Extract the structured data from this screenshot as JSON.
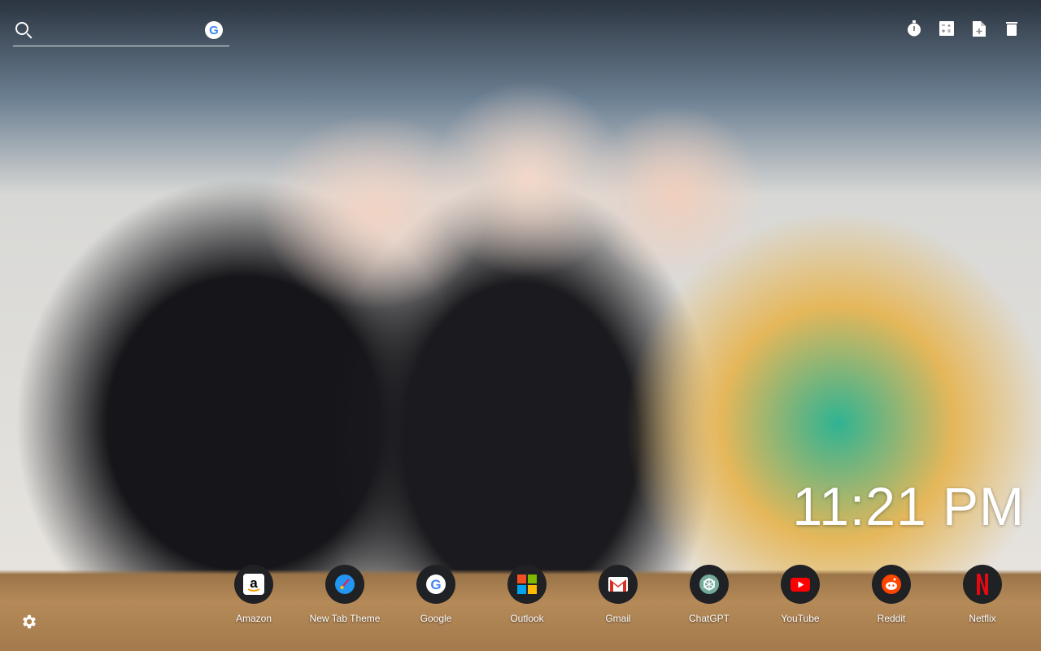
{
  "search": {
    "icon": "search-icon",
    "engine_icon": "google-icon",
    "engine_letter": "G"
  },
  "toolbar": [
    {
      "name": "timer-icon"
    },
    {
      "name": "calculator-icon"
    },
    {
      "name": "add-note-icon"
    },
    {
      "name": "trash-icon"
    }
  ],
  "clock": {
    "time": "11:21 PM"
  },
  "shortcuts": [
    {
      "label": "Amazon",
      "icon": "amazon-icon"
    },
    {
      "label": "New Tab Theme",
      "icon": "paintbrush-icon"
    },
    {
      "label": "Google",
      "icon": "google-icon"
    },
    {
      "label": "Outlook",
      "icon": "microsoft-icon"
    },
    {
      "label": "Gmail",
      "icon": "gmail-icon"
    },
    {
      "label": "ChatGPT",
      "icon": "chatgpt-icon"
    },
    {
      "label": "YouTube",
      "icon": "youtube-icon"
    },
    {
      "label": "Reddit",
      "icon": "reddit-icon"
    },
    {
      "label": "Netflix",
      "icon": "netflix-icon"
    }
  ],
  "settings": {
    "icon": "gear-icon"
  },
  "colors": {
    "shortcut_bg": "#202124",
    "text": "#ffffff"
  }
}
